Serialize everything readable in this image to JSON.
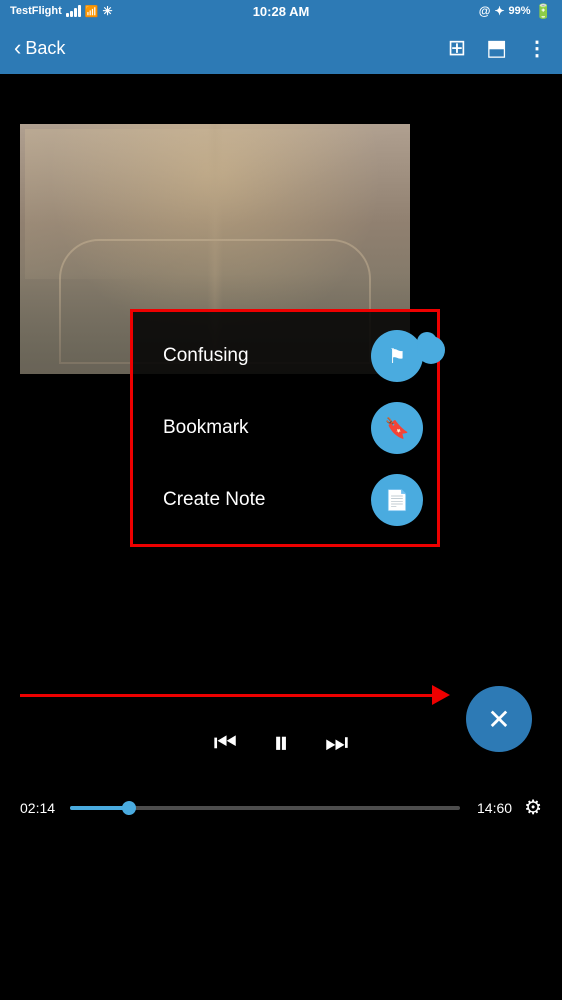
{
  "statusBar": {
    "carrier": "TestFlight",
    "time": "10:28 AM",
    "battery": "99%"
  },
  "navBar": {
    "backLabel": "Back",
    "icons": [
      "bookmark-nav-icon",
      "cast-icon",
      "more-icon"
    ]
  },
  "popupMenu": {
    "items": [
      {
        "label": "Confusing",
        "icon": "flag-icon"
      },
      {
        "label": "Bookmark",
        "icon": "bookmark-icon"
      },
      {
        "label": "Create Note",
        "icon": "note-icon"
      }
    ]
  },
  "playback": {
    "currentTime": "02:14",
    "totalTime": "14:60"
  }
}
